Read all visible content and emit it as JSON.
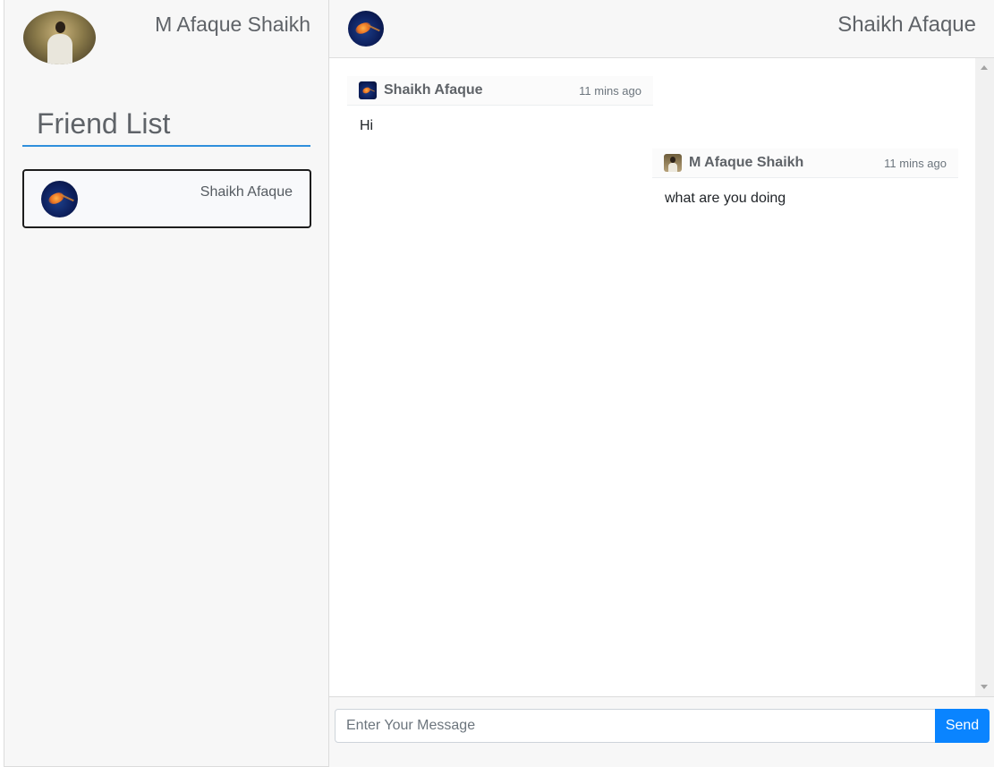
{
  "current_user": {
    "name": "M Afaque Shaikh",
    "avatar": "user-photo"
  },
  "sidebar": {
    "title": "Friend List",
    "friends": [
      {
        "name": "Shaikh Afaque",
        "avatar": "jellyfish-image",
        "selected": true
      }
    ]
  },
  "chat": {
    "header_name": "Shaikh Afaque",
    "messages": [
      {
        "sender": "Shaikh Afaque",
        "time": "11 mins ago",
        "text": "Hi",
        "side": "left"
      },
      {
        "sender": "M Afaque Shaikh",
        "time": "11 mins ago",
        "text": "what are you doing",
        "side": "right"
      }
    ]
  },
  "composer": {
    "placeholder": "Enter Your Message",
    "send_label": "Send"
  },
  "colors": {
    "accent": "#0a84ff",
    "underline": "#2f8fdc",
    "sidebar_bg": "#f7f7f7"
  }
}
